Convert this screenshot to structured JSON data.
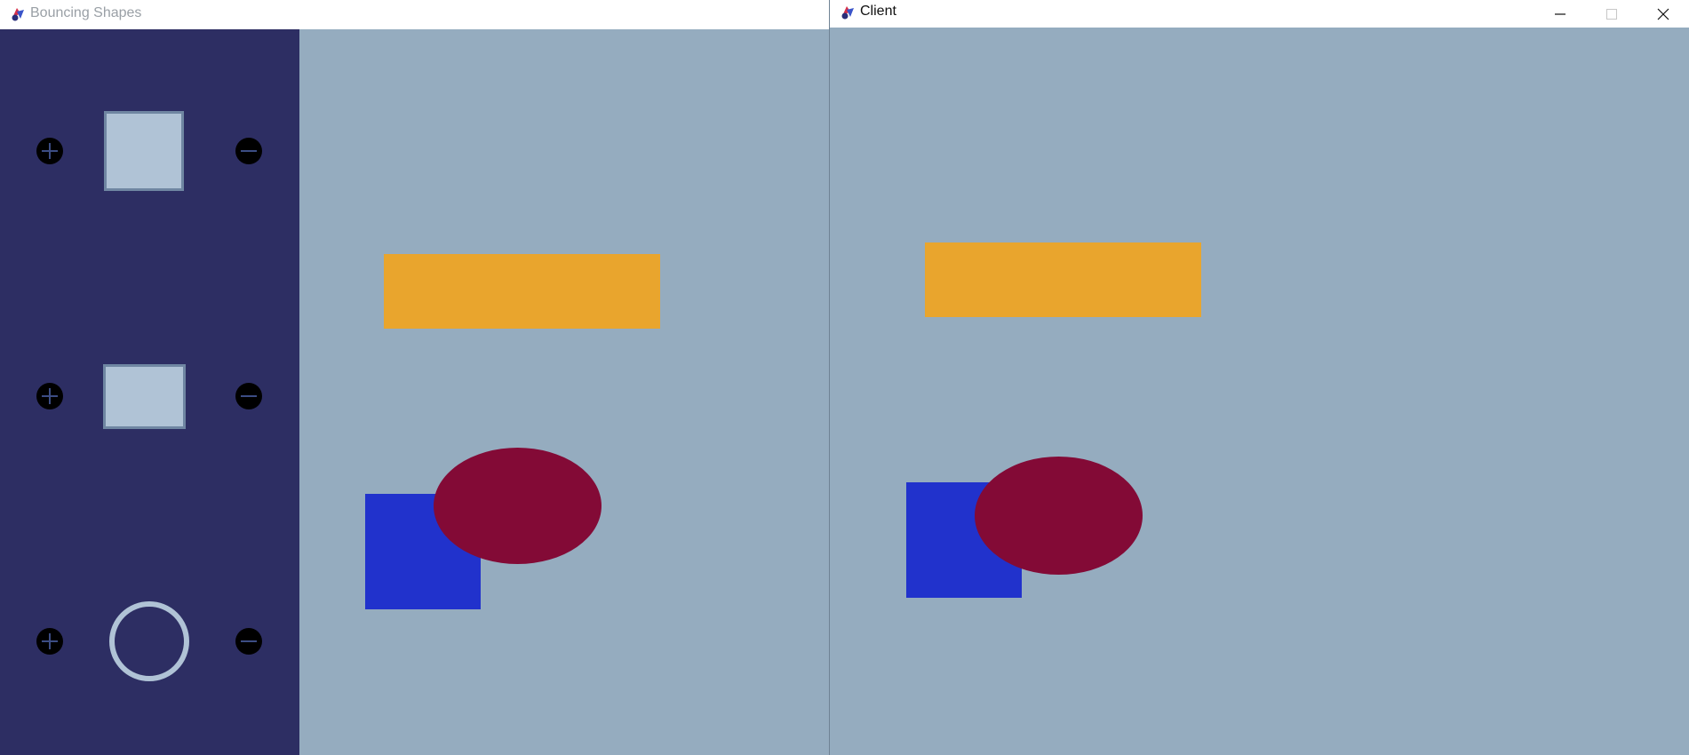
{
  "windows": {
    "left": {
      "title": "Bouncing Shapes",
      "icon": "app-icon"
    },
    "right": {
      "title": "Client",
      "icon": "app-icon",
      "caption_buttons": [
        "minimize-icon",
        "maximize-icon",
        "close-icon"
      ]
    }
  },
  "sidebar": {
    "rows": [
      {
        "shape": "square",
        "add_icon": "plus-icon",
        "remove_icon": "minus-icon"
      },
      {
        "shape": "rectangle",
        "add_icon": "plus-icon",
        "remove_icon": "minus-icon"
      },
      {
        "shape": "circle",
        "add_icon": "plus-icon",
        "remove_icon": "minus-icon"
      }
    ]
  },
  "colors": {
    "sidebar_bg": "#2d2e63",
    "canvas_bg": "#95acbf",
    "button_bg": "#000000",
    "button_glyph": "#3c4d84",
    "preview_fill": "#b0c3d6",
    "preview_border": "#6f86a2",
    "rectangle": "#e9a52d",
    "square": "#2132cc",
    "ellipse": "#830a36"
  }
}
